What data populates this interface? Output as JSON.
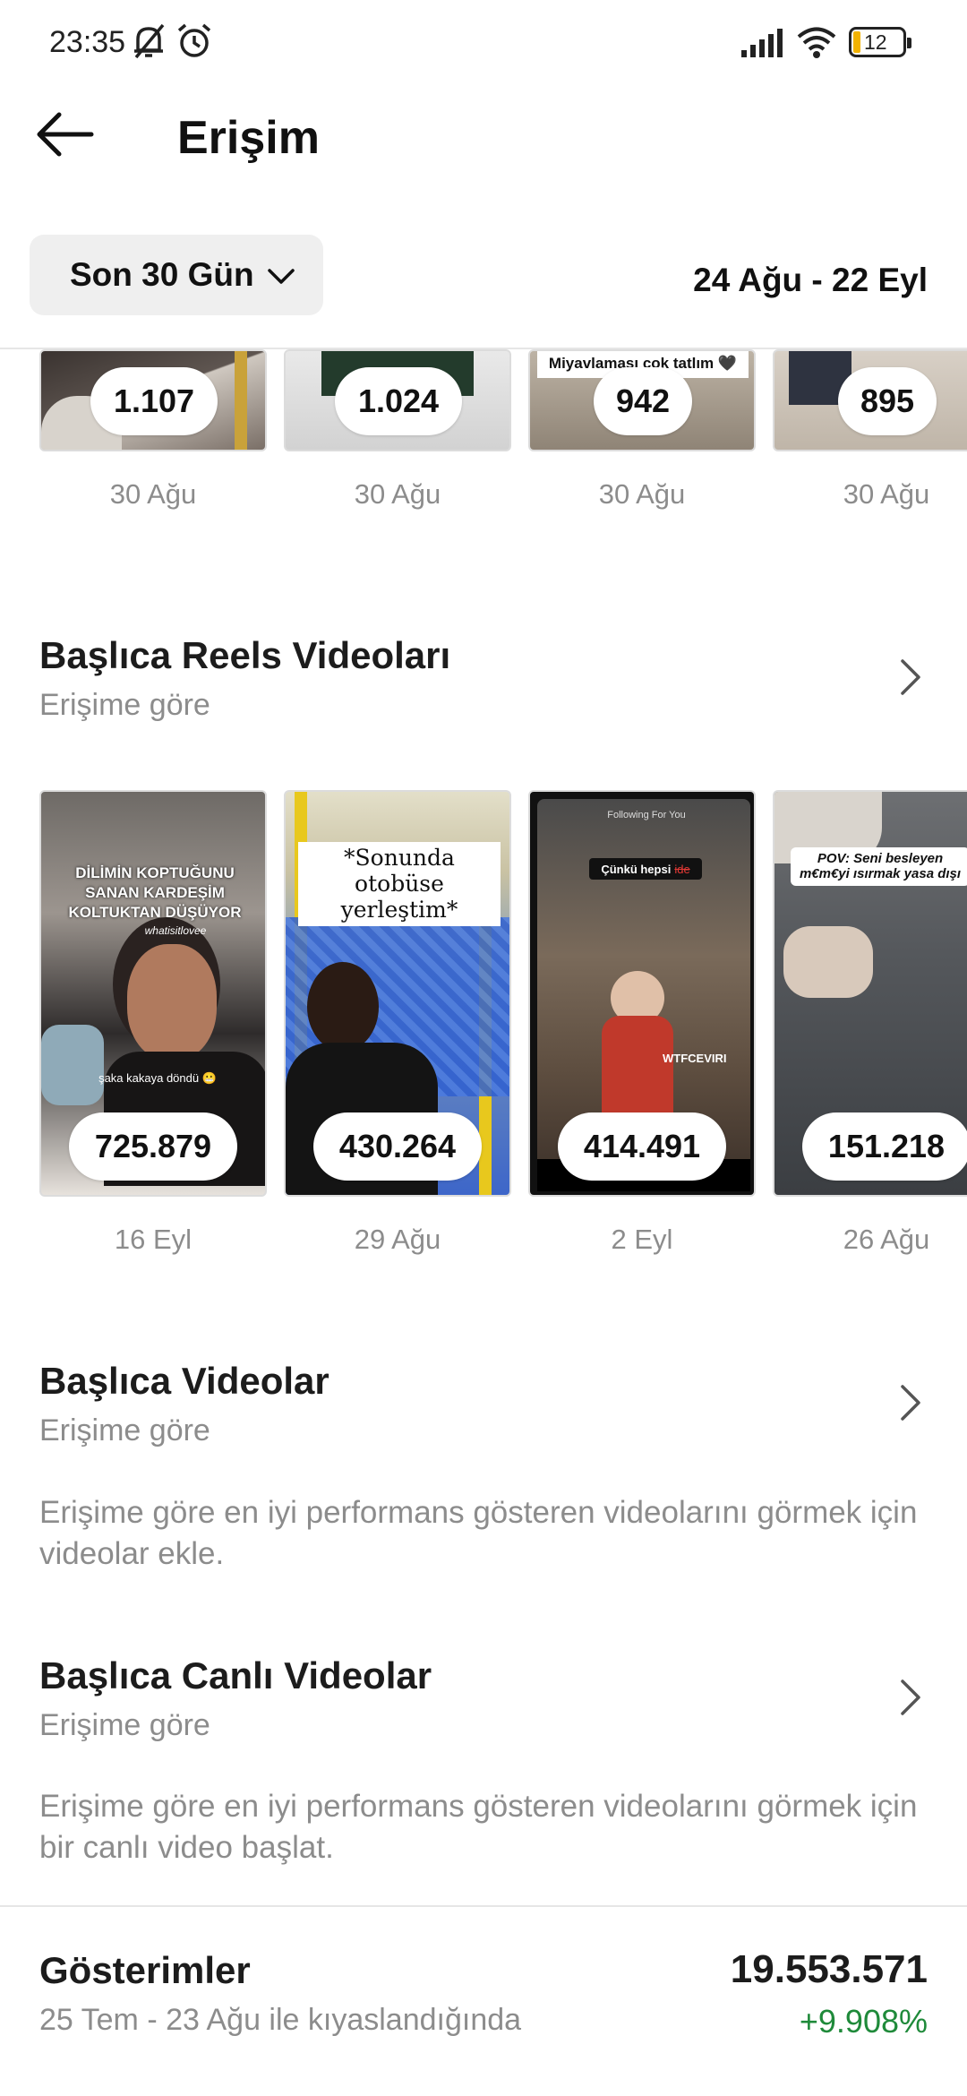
{
  "status_bar": {
    "time": "23:35",
    "battery": "12"
  },
  "header": {
    "title": "Erişim"
  },
  "filter": {
    "range_label": "Son 30 Gün",
    "date_range": "24 Ağu - 22 Eyl"
  },
  "top_row": [
    {
      "value": "1.107",
      "date": "30 Ağu"
    },
    {
      "value": "1.024",
      "date": "30 Ağu"
    },
    {
      "value": "942",
      "date": "30 Ağu",
      "caption": "Miyavlaması çok tatlım 🖤"
    },
    {
      "value": "895",
      "date": "30 Ağu"
    }
  ],
  "reels": {
    "title": "Başlıca Reels Videoları",
    "subtitle": "Erişime göre",
    "items": [
      {
        "value": "725.879",
        "date": "16 Eyl",
        "caption": "DİLİMİN KOPTUĞUNU SANAN KARDEŞİM KOLTUKTAN DÜŞÜYOR",
        "handle": "whatisitlovee",
        "subcap": "şaka kakaya döndü 😬"
      },
      {
        "value": "430.264",
        "date": "29 Ağu",
        "caption": "*Sonunda otobüse yerleştim*"
      },
      {
        "value": "414.491",
        "date": "2 Eyl",
        "caption": "Çünkü hepsi",
        "caption_strike": "ide",
        "watermark": "WTFCEVIRI",
        "tabs": "Following  For You"
      },
      {
        "value": "151.218",
        "date": "26 Ağu",
        "caption": "POV: Seni besleyen m€m€yi ısırmak yasa dışı"
      }
    ]
  },
  "videos": {
    "title": "Başlıca Videolar",
    "subtitle": "Erişime göre",
    "description": "Erişime göre en iyi performans gösteren videolarını görmek için videolar ekle."
  },
  "live": {
    "title": "Başlıca Canlı Videolar",
    "subtitle": "Erişime göre",
    "description": "Erişime göre en iyi performans gösteren videolarını görmek için bir canlı video başlat."
  },
  "impressions": {
    "title": "Gösterimler",
    "subtitle": "25 Tem - 23 Ağu ile kıyaslandığında",
    "value": "19.553.571",
    "change": "+9.908%"
  }
}
